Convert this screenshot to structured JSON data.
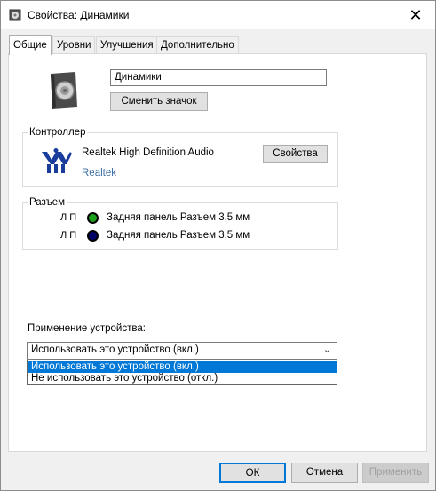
{
  "window": {
    "title": "Свойства: Динамики",
    "close_glyph": "✕"
  },
  "tabs": [
    {
      "label": "Общие",
      "active": true
    },
    {
      "label": "Уровни",
      "active": false
    },
    {
      "label": "Улучшения",
      "active": false
    },
    {
      "label": "Дополнительно",
      "active": false
    }
  ],
  "general": {
    "device_name": "Динамики",
    "change_icon_label": "Сменить значок",
    "controller": {
      "group_label": "Контроллер",
      "name": "Realtek High Definition Audio",
      "vendor_link": "Realtek",
      "properties_label": "Свойства"
    },
    "jack": {
      "group_label": "Разъем",
      "rows": [
        {
          "channels": "Л П",
          "color": "#1aa01a",
          "label": "Задняя панель Разъем 3,5 мм"
        },
        {
          "channels": "Л П",
          "color": "#000066",
          "label": "Задняя панель Разъем 3,5 мм"
        }
      ]
    },
    "usage": {
      "label": "Применение устройства:",
      "selected": "Использовать это устройство (вкл.)",
      "options": [
        "Использовать это устройство (вкл.)",
        "Не использовать это устройство (откл.)"
      ]
    }
  },
  "footer": {
    "ok_label": "ОК",
    "cancel_label": "Отмена",
    "apply_label": "Применить"
  },
  "colors": {
    "accent": "#0078d7",
    "link": "#3d6fa6",
    "disabled_text": "#a0a0a0"
  }
}
